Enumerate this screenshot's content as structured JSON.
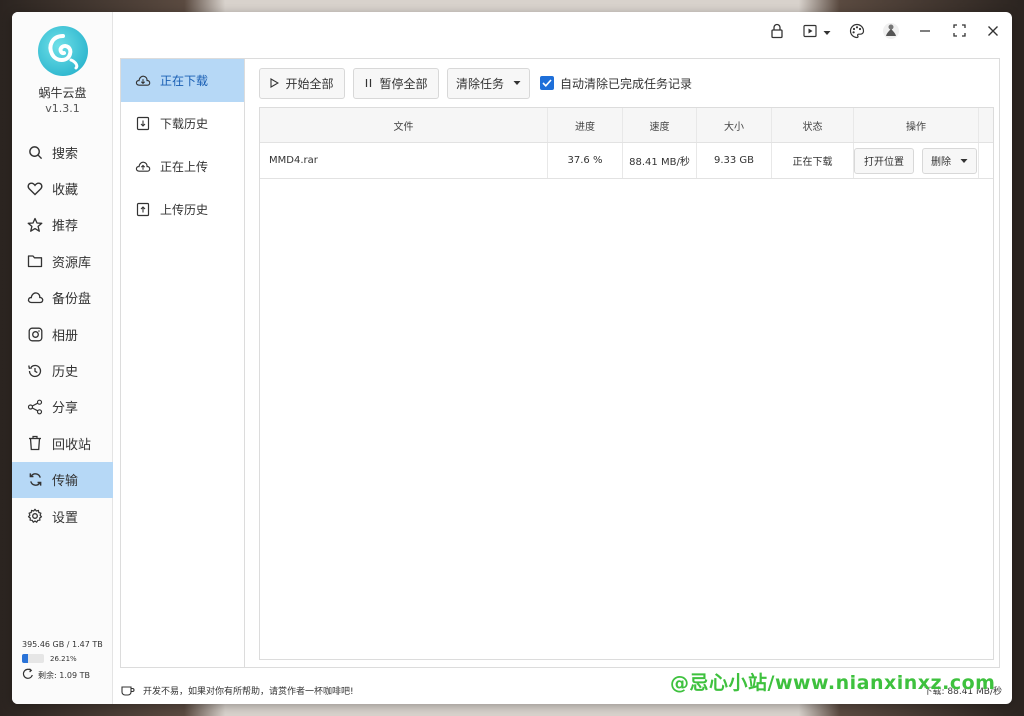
{
  "app": {
    "name": "蜗牛云盘",
    "version": "v1.3.1"
  },
  "sidebar": {
    "items": [
      {
        "label": "搜索",
        "icon": "search-icon"
      },
      {
        "label": "收藏",
        "icon": "heart-icon"
      },
      {
        "label": "推荐",
        "icon": "star-icon"
      },
      {
        "label": "资源库",
        "icon": "folder-icon"
      },
      {
        "label": "备份盘",
        "icon": "cloud-icon"
      },
      {
        "label": "相册",
        "icon": "camera-icon"
      },
      {
        "label": "历史",
        "icon": "history-icon"
      },
      {
        "label": "分享",
        "icon": "share-icon"
      },
      {
        "label": "回收站",
        "icon": "trash-icon"
      },
      {
        "label": "传输",
        "icon": "sync-icon",
        "active": true
      },
      {
        "label": "设置",
        "icon": "gear-icon"
      }
    ],
    "storage": {
      "used": "395.46 GB / 1.47 TB",
      "percent_label": "26.21%",
      "percent": 0.2621,
      "free": "剩余: 1.09 TB"
    }
  },
  "transfer_nav": [
    {
      "label": "正在下载",
      "icon": "cloud-download-icon",
      "active": true
    },
    {
      "label": "下载历史",
      "icon": "download-history-icon"
    },
    {
      "label": "正在上传",
      "icon": "cloud-upload-icon"
    },
    {
      "label": "上传历史",
      "icon": "upload-history-icon"
    }
  ],
  "toolbar": {
    "start_all": "开始全部",
    "pause_all": "暂停全部",
    "clear_tasks": "清除任务",
    "auto_clear": "自动清除已完成任务记录",
    "auto_clear_checked": true
  },
  "table": {
    "headers": {
      "file": "文件",
      "progress": "进度",
      "speed": "速度",
      "size": "大小",
      "status": "状态",
      "ops": "操作"
    },
    "rows": [
      {
        "file": "MMD4.rar",
        "progress": "37.6 %",
        "speed": "88.41 MB/秒",
        "size": "9.33 GB",
        "status": "正在下载",
        "open": "打开位置",
        "delete": "删除"
      }
    ]
  },
  "statusbar": {
    "message": "开发不易，如果对你有所帮助，请赏作者一杯咖啡吧!",
    "download_speed": "下载: 88.41 MB/秒"
  },
  "watermark": "@忌心小站/www.nianxinxz.com",
  "colors": {
    "accent": "#1e6fd9",
    "active_bg": "#b6d8f6",
    "watermark": "#3ec13e"
  }
}
